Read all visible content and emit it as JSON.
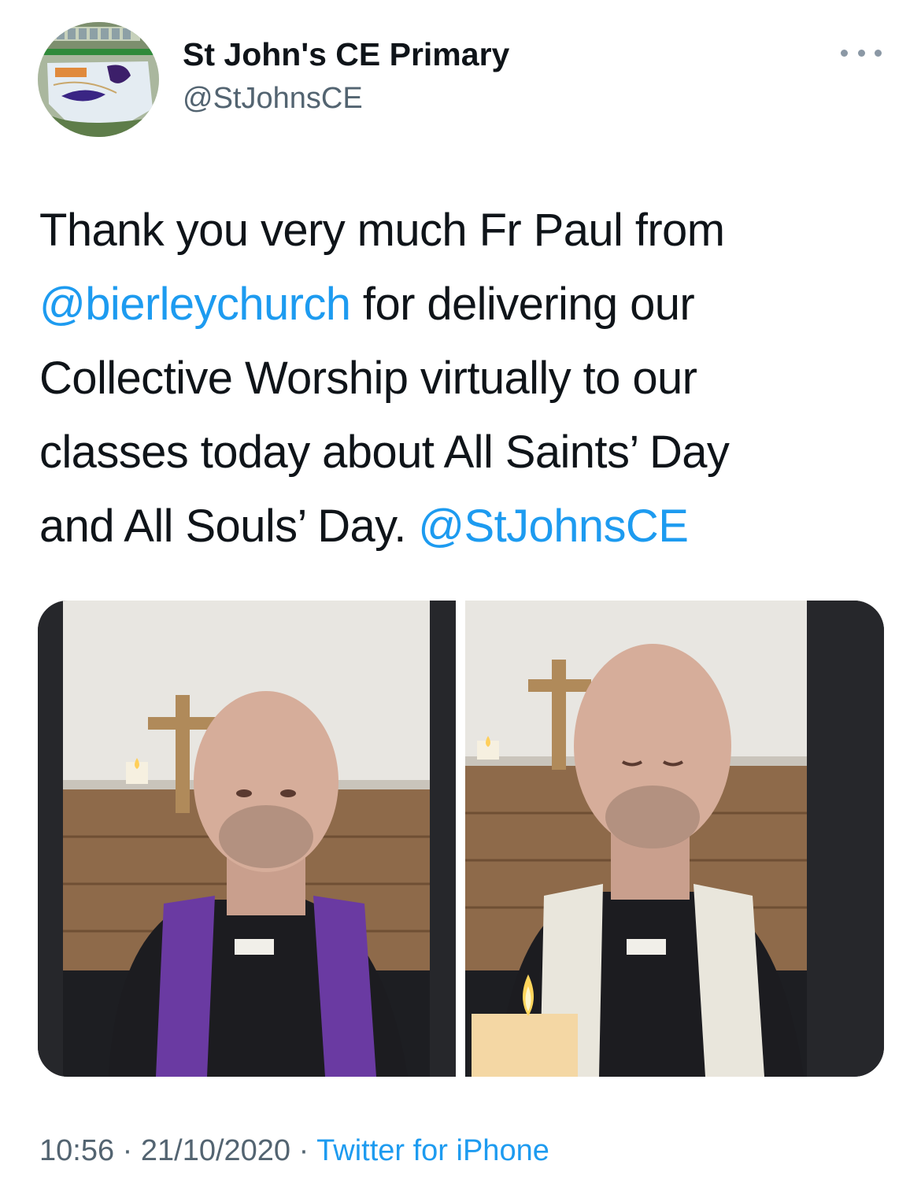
{
  "author": {
    "display_name": "St John's CE Primary",
    "handle": "@StJohnsCE",
    "avatar_icon": "school-badge-avatar"
  },
  "more_icon": "more-dots-icon",
  "text": {
    "line1": "Thank you very much Fr Paul from",
    "mention1": "@bierleychurch",
    "line2_rest": " for delivering our",
    "line3": "Collective Worship virtually to our",
    "line4": "classes today about All Saints’ Day",
    "line5": "and All Souls’ Day. ",
    "mention2": "@StJohnsCE"
  },
  "meta": {
    "time": "10:56",
    "sep1": " · ",
    "date": "21/10/2020",
    "sep2": " · ",
    "source": "Twitter for iPhone"
  },
  "colors": {
    "link": "#1d9bf0",
    "secondary_text": "#536471",
    "stole_purple": "#6a3aa2",
    "stole_white": "#e9e6dc"
  }
}
